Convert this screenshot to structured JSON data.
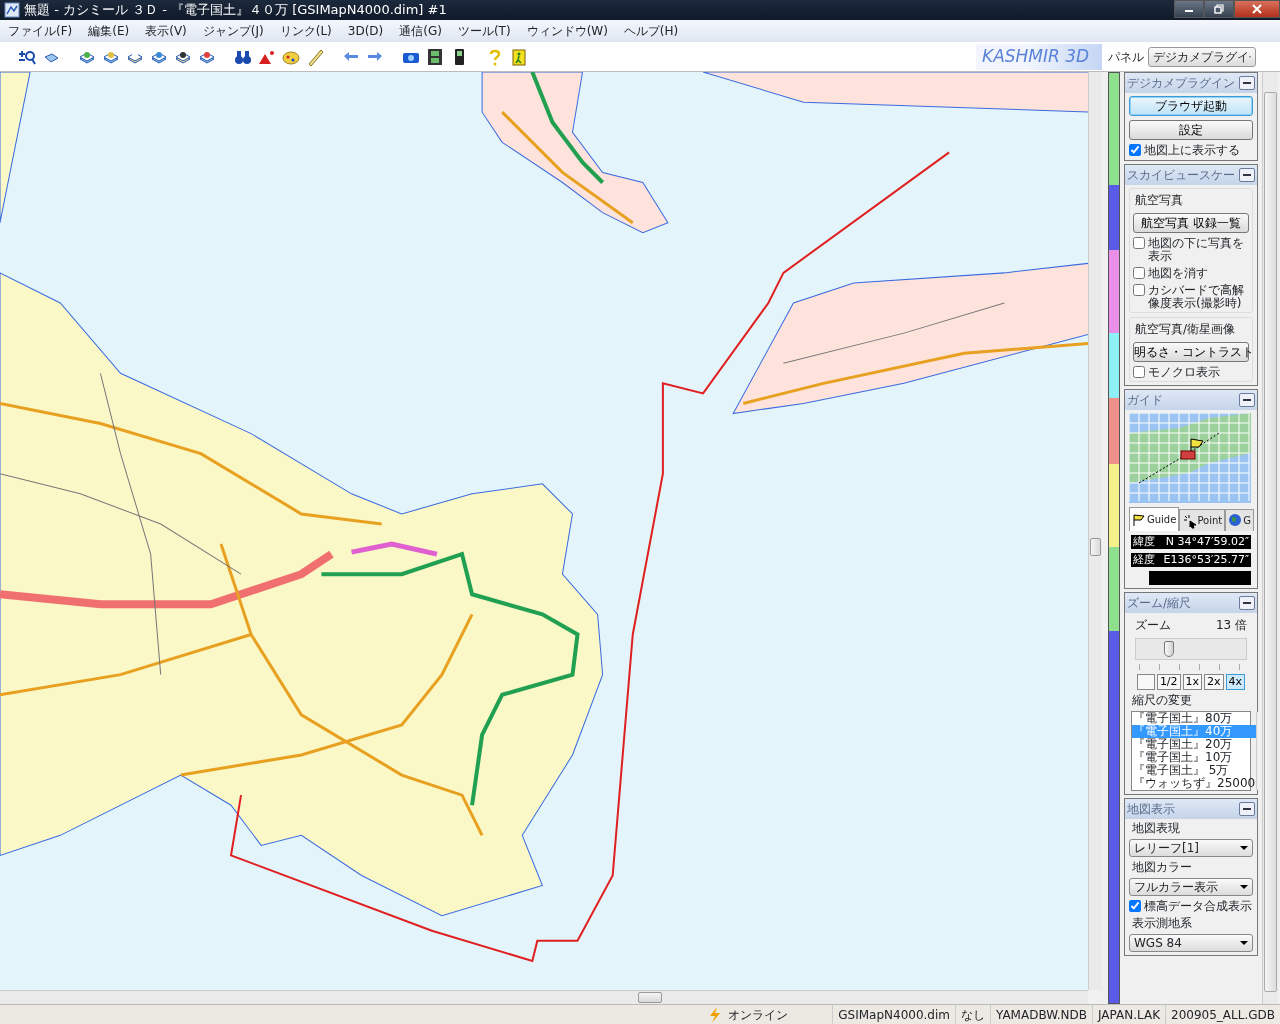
{
  "window": {
    "title": "無題 - カシミール ３Ｄ - 『電子国土』４０万 [GSIMapN4000.dim] #1"
  },
  "menu": [
    "ファイル(F)",
    "編集(E)",
    "表示(V)",
    "ジャンプ(J)",
    "リンク(L)",
    "3D(D)",
    "通信(G)",
    "ツール(T)",
    "ウィンドウ(W)",
    "ヘルプ(H)"
  ],
  "toolbar": {
    "logo": "KASHMIR 3D",
    "panel_label": "パネル",
    "panel_select": "デジカメプラグイ"
  },
  "plugin_panel": {
    "title": "デジカメプラグイン",
    "buttons": [
      {
        "label": "ブラウザ起動",
        "default": true
      },
      {
        "label": "設定",
        "default": false
      }
    ],
    "checkbox": {
      "label": "地図上に表示する",
      "checked": true
    }
  },
  "skyview_panel": {
    "title": "スカイビュースケー",
    "groups": [
      {
        "title": "航空写真",
        "button": "航空写真 収録一覧",
        "checkboxes": [
          {
            "label": "地図の下に写真を表示",
            "checked": false
          },
          {
            "label": "地図を消す",
            "checked": false
          },
          {
            "label": "カシバードで高解像度表示(撮影時)",
            "checked": false
          }
        ]
      },
      {
        "title": "航空写真/衛星画像",
        "button": "明るさ・コントラスト",
        "checkboxes": [
          {
            "label": "モノクロ表示",
            "checked": false
          }
        ]
      }
    ]
  },
  "guide_panel": {
    "title": "ガイド",
    "tabs": [
      {
        "label": "Guide",
        "selected": true
      },
      {
        "label": "Point",
        "selected": false
      },
      {
        "label": "G",
        "selected": false
      }
    ],
    "coords": [
      {
        "label": "緯度",
        "value": "N 34°47′59.02″"
      },
      {
        "label": "経度",
        "value": "E136°53′25.77″"
      }
    ]
  },
  "zoom_panel": {
    "title": "ズーム/縮尺",
    "zoom_label": "ズーム",
    "zoom_value": "13 倍",
    "slider": {
      "level": 0.3
    },
    "zoom_buttons": [
      {
        "label": "1/2",
        "selected": false
      },
      {
        "label": "1x",
        "selected": false
      },
      {
        "label": "2x",
        "selected": false
      },
      {
        "label": "4x",
        "selected": true
      }
    ],
    "scale_heading": "縮尺の変更",
    "scale_list": [
      {
        "label": "『電子国土』80万",
        "selected": false
      },
      {
        "label": "『電子国土』40万",
        "selected": true
      },
      {
        "label": "『電子国土』20万",
        "selected": false
      },
      {
        "label": "『電子国土』10万",
        "selected": false
      },
      {
        "label": "『電子国土』 5万",
        "selected": false
      },
      {
        "label": "『ウォッちず』25000",
        "selected": false
      }
    ]
  },
  "map_panel": {
    "title": "地図表示",
    "fields": [
      {
        "label": "地図表現",
        "value": "レリーフ[1]"
      },
      {
        "label": "地図カラー",
        "value": "フルカラー表示"
      }
    ],
    "checkbox": {
      "label": "標高データ合成表示",
      "checked": true
    },
    "datum": {
      "label": "表示測地系",
      "value": "WGS 84"
    }
  },
  "status_bar": {
    "connection": "オンライン",
    "cells": [
      "GSIMapN4000.dim",
      "なし",
      "YAMADBW.NDB",
      "JAPAN.LAK",
      "200905_ALL.GDB"
    ]
  }
}
